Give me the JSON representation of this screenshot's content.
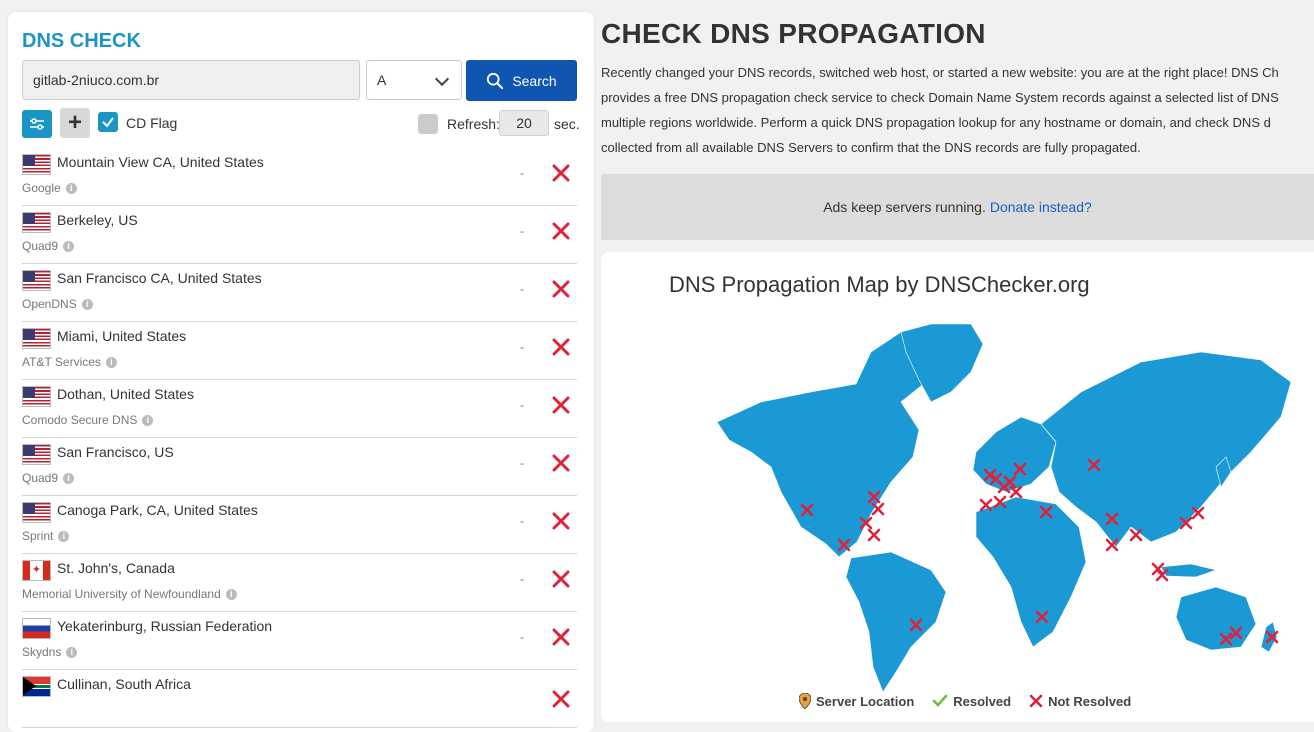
{
  "dns_check": {
    "title": "DNS CHECK",
    "domain_value": "gitlab-2niuco.com.br",
    "record_type": "A",
    "search_label": "Search",
    "cd_flag_label": "CD Flag",
    "refresh_label": "Refresh:",
    "refresh_value": "20",
    "refresh_unit": "sec."
  },
  "servers": [
    {
      "flag": "us",
      "location": "Mountain View CA, United States",
      "provider": "Google",
      "result": "-",
      "status": "not-resolved"
    },
    {
      "flag": "us",
      "location": "Berkeley, US",
      "provider": "Quad9",
      "result": "-",
      "status": "not-resolved"
    },
    {
      "flag": "us",
      "location": "San Francisco CA, United States",
      "provider": "OpenDNS",
      "result": "-",
      "status": "not-resolved"
    },
    {
      "flag": "us",
      "location": "Miami, United States",
      "provider": "AT&T Services",
      "result": "-",
      "status": "not-resolved"
    },
    {
      "flag": "us",
      "location": "Dothan, United States",
      "provider": "Comodo Secure DNS",
      "result": "-",
      "status": "not-resolved"
    },
    {
      "flag": "us",
      "location": "San Francisco, US",
      "provider": "Quad9",
      "result": "-",
      "status": "not-resolved"
    },
    {
      "flag": "us",
      "location": "Canoga Park, CA, United States",
      "provider": "Sprint",
      "result": "-",
      "status": "not-resolved"
    },
    {
      "flag": "ca",
      "location": "St. John's, Canada",
      "provider": "Memorial University of Newfoundland",
      "result": "-",
      "status": "not-resolved"
    },
    {
      "flag": "ru",
      "location": "Yekaterinburg, Russian Federation",
      "provider": "Skydns",
      "result": "-",
      "status": "not-resolved"
    },
    {
      "flag": "za",
      "location": "Cullinan, South Africa",
      "provider": "",
      "result": "",
      "status": "not-resolved"
    }
  ],
  "header": {
    "title": "CHECK DNS PROPAGATION",
    "intro_lines": [
      "Recently changed your DNS records, switched web host, or started a new website: you are at the right place! DNS Ch",
      "provides a free DNS propagation check service to check Domain Name System records against a selected list of DNS",
      "multiple regions worldwide. Perform a quick DNS propagation lookup for any hostname or domain, and check DNS d",
      "collected from all available DNS Servers to confirm that the DNS records are fully propagated."
    ]
  },
  "ad": {
    "text": "Ads keep servers running.",
    "link": "Donate instead?"
  },
  "map": {
    "title": "DNS Propagation Map by DNSChecker.org",
    "legend": {
      "server": "Server Location",
      "resolved": "Resolved",
      "not_resolved": "Not Resolved"
    }
  },
  "colors": {
    "accent": "#1a95c6",
    "search_button": "#0f56b3",
    "not_resolved": "#e0213a",
    "resolved": "#6abf3f",
    "map_land": "#1b99d4"
  }
}
